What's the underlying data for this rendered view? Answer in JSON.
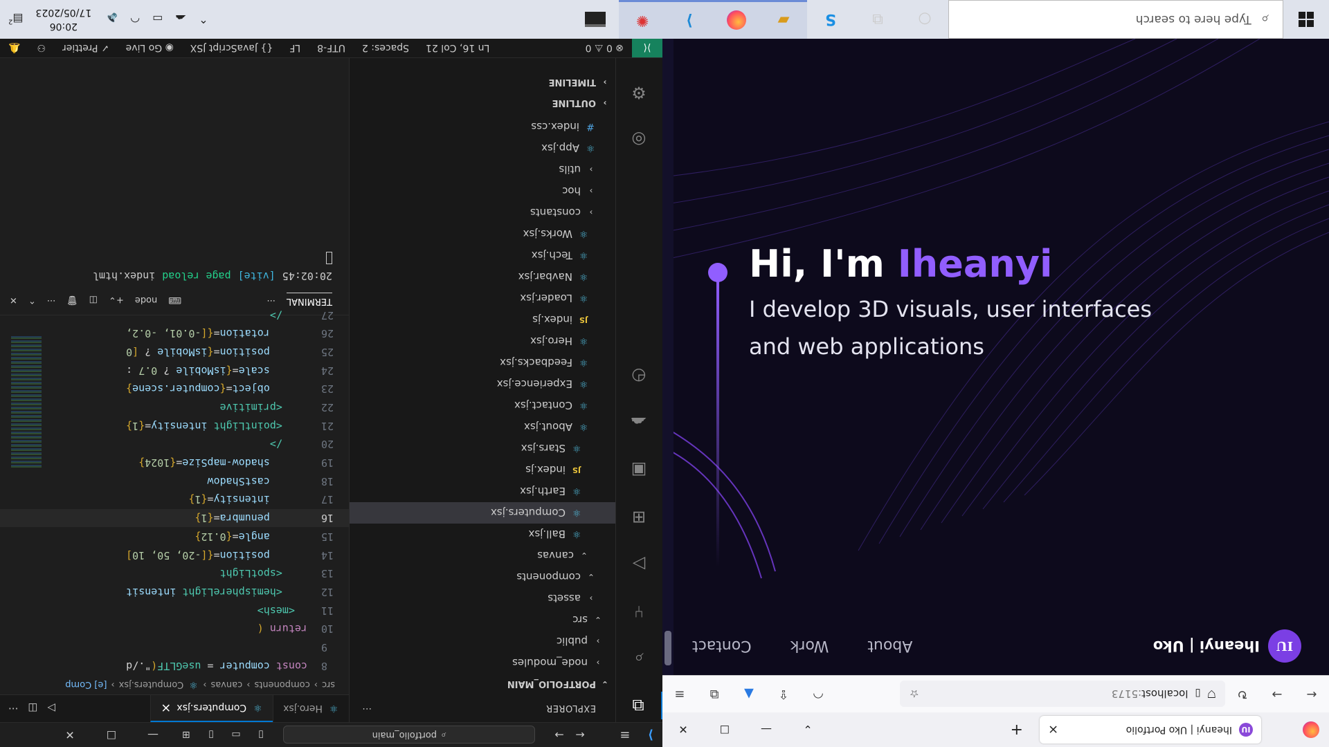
{
  "vscode": {
    "titlebar": {
      "search_text": "portfolio_main",
      "nav_back": "←",
      "nav_forward": "→"
    },
    "explorer": {
      "header": "EXPLORER",
      "more": "···",
      "section_title": "PORTFOLIO_MAIN",
      "outline": "OUTLINE",
      "timeline": "TIMELINE",
      "tree": [
        {
          "label": "node_modules",
          "indent": 1,
          "kind": "folder-closed"
        },
        {
          "label": "public",
          "indent": 1,
          "kind": "folder-closed"
        },
        {
          "label": "src",
          "indent": 1,
          "kind": "folder-open"
        },
        {
          "label": "assets",
          "indent": 2,
          "kind": "folder-closed"
        },
        {
          "label": "components",
          "indent": 2,
          "kind": "folder-open"
        },
        {
          "label": "canvas",
          "indent": 3,
          "kind": "folder-open"
        },
        {
          "label": "Ball.jsx",
          "indent": 4,
          "kind": "react"
        },
        {
          "label": "Computers.jsx",
          "indent": 4,
          "kind": "react",
          "selected": true
        },
        {
          "label": "Earth.jsx",
          "indent": 4,
          "kind": "react"
        },
        {
          "label": "index.js",
          "indent": 4,
          "kind": "js"
        },
        {
          "label": "Stars.jsx",
          "indent": 4,
          "kind": "react"
        },
        {
          "label": "About.jsx",
          "indent": 3,
          "kind": "react"
        },
        {
          "label": "Contact.jsx",
          "indent": 3,
          "kind": "react"
        },
        {
          "label": "Experience.jsx",
          "indent": 3,
          "kind": "react"
        },
        {
          "label": "Feedbacks.jsx",
          "indent": 3,
          "kind": "react"
        },
        {
          "label": "Hero.jsx",
          "indent": 3,
          "kind": "react"
        },
        {
          "label": "index.js",
          "indent": 3,
          "kind": "js"
        },
        {
          "label": "Loader.jsx",
          "indent": 3,
          "kind": "react"
        },
        {
          "label": "Navbar.jsx",
          "indent": 3,
          "kind": "react"
        },
        {
          "label": "Tech.jsx",
          "indent": 3,
          "kind": "react"
        },
        {
          "label": "Works.jsx",
          "indent": 3,
          "kind": "react"
        },
        {
          "label": "constants",
          "indent": 2,
          "kind": "folder-closed"
        },
        {
          "label": "hoc",
          "indent": 2,
          "kind": "folder-closed"
        },
        {
          "label": "utils",
          "indent": 2,
          "kind": "folder-closed"
        },
        {
          "label": "App.jsx",
          "indent": 2,
          "kind": "react"
        },
        {
          "label": "index.css",
          "indent": 2,
          "kind": "css"
        }
      ]
    },
    "editor": {
      "tabs": [
        {
          "label": "Hero.jsx",
          "active": false
        },
        {
          "label": "Computers.jsx",
          "active": true
        }
      ],
      "tab_close": "×",
      "breadcrumb": [
        "src",
        "components",
        "canvas",
        "Computers.jsx",
        "[e] Comp"
      ],
      "current_line": 16,
      "lines": [
        {
          "n": 8,
          "html": "<span class='kw'>const</span> <span class='attr'>computer</span> <span class='plain'>=</span> <span class='tag'>useGLTF</span><span class='br'>(</span><span class='plain'>\"./d</span>"
        },
        {
          "n": 9,
          "html": ""
        },
        {
          "n": 10,
          "html": "<span class='kw'>return</span> <span class='br'>(</span>"
        },
        {
          "n": 11,
          "html": "  <span class='tag'>&lt;mesh&gt;</span>"
        },
        {
          "n": 12,
          "html": "    <span class='tag'>&lt;hemisphereLight</span> <span class='attr'>intensit</span>"
        },
        {
          "n": 13,
          "html": "    <span class='tag'>&lt;spotLight</span>"
        },
        {
          "n": 14,
          "html": "      <span class='attr'>position</span><span class='plain'>=</span><span class='br'>{[</span><span class='num'>-20, 50, 10</span><span class='br'>]</span>"
        },
        {
          "n": 15,
          "html": "      <span class='attr'>angle</span><span class='plain'>=</span><span class='br'>{</span><span class='num'>0.12</span><span class='br'>}</span>"
        },
        {
          "n": 16,
          "html": "      <span class='attr'>penumbra</span><span class='plain'>=</span><span class='br'>{</span><span class='num'>1</span><span class='br'>}</span>"
        },
        {
          "n": 17,
          "html": "      <span class='attr'>intensity</span><span class='plain'>=</span><span class='br'>{</span><span class='num'>1</span><span class='br'>}</span>"
        },
        {
          "n": 18,
          "html": "      <span class='attr'>castShadow</span>"
        },
        {
          "n": 19,
          "html": "      <span class='attr'>shadow-mapSize</span><span class='plain'>=</span><span class='br'>{</span><span class='num'>1024</span><span class='br'>}</span>"
        },
        {
          "n": 20,
          "html": "    <span class='tag'>/&gt;</span>"
        },
        {
          "n": 21,
          "html": "    <span class='tag'>&lt;pointLight</span> <span class='attr'>intensity</span><span class='plain'>=</span><span class='br'>{</span><span class='num'>1</span><span class='br'>}</span>"
        },
        {
          "n": 22,
          "html": "    <span class='tag'>&lt;primitive</span>"
        },
        {
          "n": 23,
          "html": "      <span class='attr'>object</span><span class='plain'>=</span><span class='br'>{</span><span class='attr'>computer.scene</span><span class='br'>}</span>"
        },
        {
          "n": 24,
          "html": "      <span class='attr'>scale</span><span class='plain'>=</span><span class='br'>{</span><span class='attr'>isMobile</span> <span class='plain'>?</span> <span class='num'>0.7</span> <span class='plain'>:</span>"
        },
        {
          "n": 25,
          "html": "      <span class='attr'>position</span><span class='plain'>=</span><span class='br'>{</span><span class='attr'>isMobile</span> <span class='plain'>?</span> <span class='br'>[</span><span class='num'>0</span>"
        },
        {
          "n": 26,
          "html": "      <span class='attr'>rotation</span><span class='plain'>=</span><span class='br'>{[</span><span class='num'>-0.01, -0.2,</span>"
        },
        {
          "n": 27,
          "html": "    <span class='tag'>/&gt;</span>"
        }
      ]
    },
    "terminal": {
      "title": "TERMINAL",
      "more": "···",
      "shell": "node",
      "log_time": "20:02:45",
      "log_tag": "[vite]",
      "log_msg": "page reload",
      "log_file": "index.html"
    },
    "statusbar": {
      "problems": "⊗ 0 ⚠ 0",
      "position": "Ln 16, Col 21",
      "spaces": "Spaces: 2",
      "encoding": "UTF-8",
      "eol": "LF",
      "language": "{} JavaScript JSX",
      "golive": "Go Live",
      "prettier": "✓ Prettier"
    }
  },
  "browser": {
    "tab_title": "Iheanyi | Uko Portfolio",
    "favicon_text": "IU",
    "tab_close": "×",
    "new_tab": "+",
    "url_host": "localhost",
    "url_port": ":5173",
    "page": {
      "brand": "Iheanyi | Uko",
      "logo_text": "IU",
      "nav": [
        "About",
        "Work",
        "Contact"
      ],
      "hero_prefix": "Hi, I'm ",
      "hero_name": "Iheanyi",
      "hero_sub": "I develop 3D visuals, user interfaces and web applications",
      "accent": "#915eff"
    }
  },
  "taskbar": {
    "search_placeholder": "Type here to search",
    "apps": [
      "cortana-icon",
      "task-view-icon",
      "grammarly-icon",
      "file-explorer-icon",
      "firefox-icon",
      "vscode-icon",
      "app-icon",
      "terminal-icon"
    ],
    "time": "20:06",
    "date": "17/05/2023",
    "notifications": "2"
  }
}
